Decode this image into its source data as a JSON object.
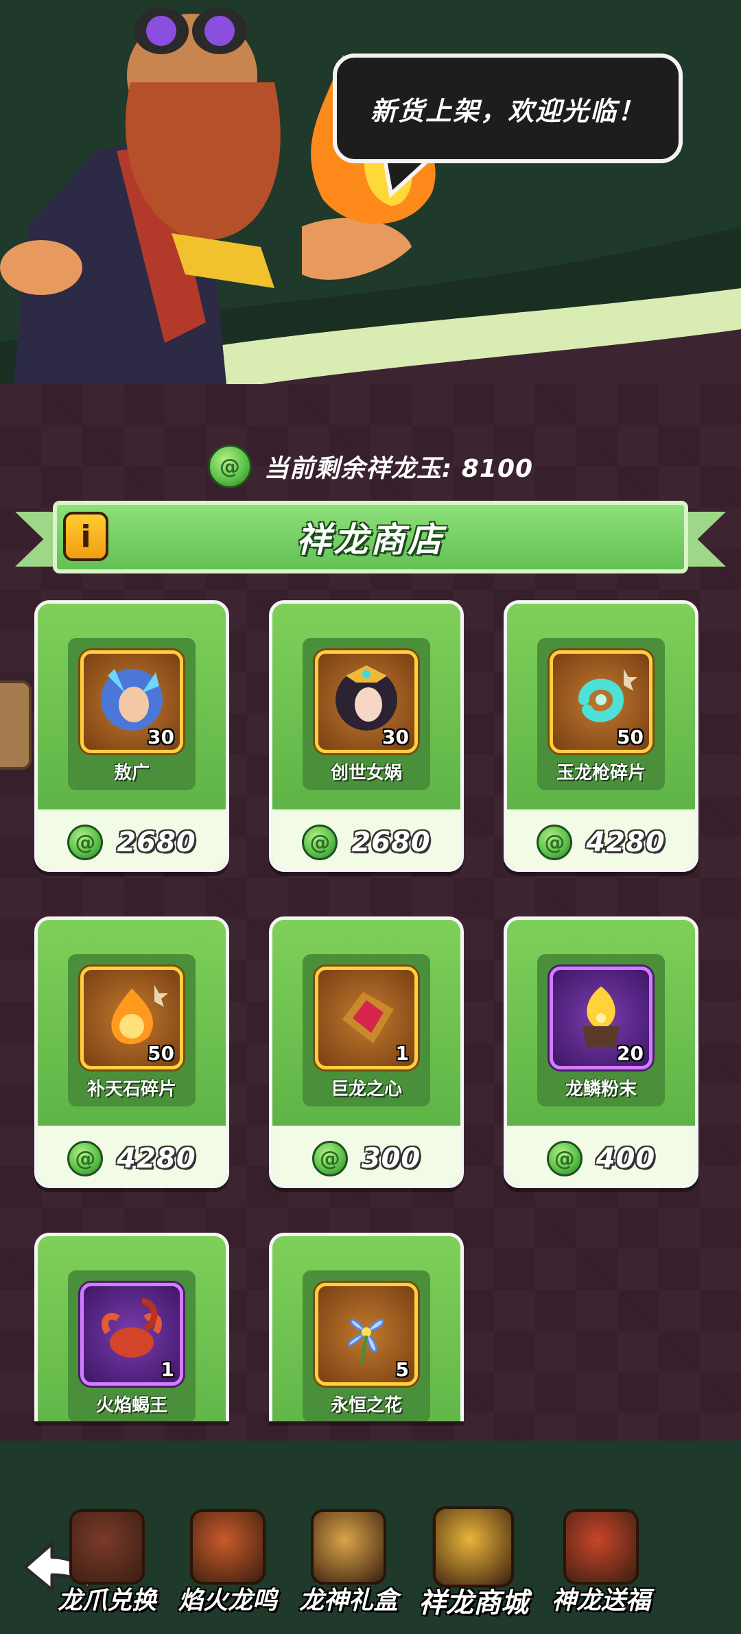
{
  "speech": {
    "text": "新货上架，欢迎光临！"
  },
  "balance": {
    "label": "当前剩余祥龙玉: 8100"
  },
  "banner": {
    "title": "祥龙商店",
    "info_icon": "i"
  },
  "items": [
    {
      "name": "敖广",
      "qty": "30",
      "price": "2680",
      "frame": "gold",
      "icon": "dragon-king-portrait-icon"
    },
    {
      "name": "创世女娲",
      "qty": "30",
      "price": "2680",
      "frame": "gold",
      "icon": "nuwa-portrait-icon"
    },
    {
      "name": "玉龙枪碎片",
      "qty": "50",
      "price": "4280",
      "frame": "gold",
      "icon": "jade-dragon-shard-icon"
    },
    {
      "name": "补天石碎片",
      "qty": "50",
      "price": "4280",
      "frame": "gold",
      "icon": "sky-stone-shard-icon"
    },
    {
      "name": "巨龙之心",
      "qty": "1",
      "price": "300",
      "frame": "gold",
      "icon": "dragon-heart-icon"
    },
    {
      "name": "龙鳞粉末",
      "qty": "20",
      "price": "400",
      "frame": "purple",
      "icon": "dragon-scale-powder-icon"
    },
    {
      "name": "火焰蝎王",
      "qty": "1",
      "price": "",
      "frame": "purple",
      "icon": "fire-scorpion-icon"
    },
    {
      "name": "永恒之花",
      "qty": "5",
      "price": "",
      "frame": "gold",
      "icon": "eternal-flower-icon"
    }
  ],
  "nav": [
    {
      "label": "龙爪兑换",
      "icon": "dragon-claw-icon"
    },
    {
      "label": "焰火龙鸣",
      "icon": "fire-dragon-icon"
    },
    {
      "label": "龙神礼盒",
      "icon": "gift-chest-icon"
    },
    {
      "label": "祥龙商城",
      "icon": "shop-icon",
      "active": true
    },
    {
      "label": "神龙送福",
      "icon": "dragon-blessing-icon"
    }
  ],
  "colors": {
    "accent_green": "#6fc24f",
    "dark_green": "#1f3a2b",
    "background": "#3d2431",
    "gold_frame": "#ffcf3d",
    "purple_frame": "#d37cff"
  }
}
